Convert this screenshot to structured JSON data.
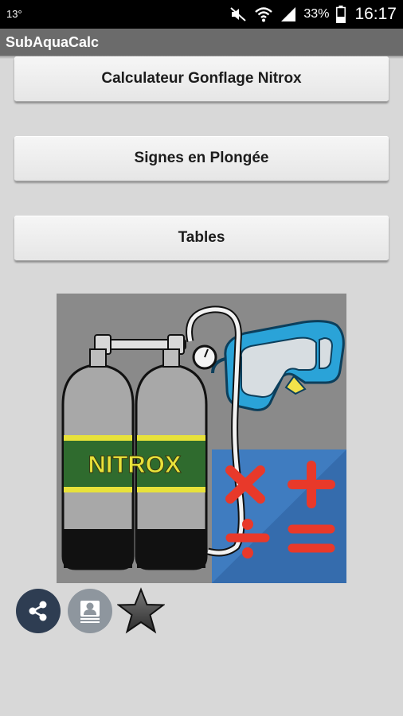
{
  "status_bar": {
    "temperature": "13°",
    "battery_percent": "33%",
    "time": "16:17",
    "icons": [
      "mute-icon",
      "wifi-icon",
      "signal-icon",
      "battery-icon"
    ]
  },
  "app": {
    "title": "SubAquaCalc"
  },
  "menu": {
    "buttons": [
      {
        "label": "Calculateur Gonflage Nitrox"
      },
      {
        "label": "Signes en Plongée"
      },
      {
        "label": "Tables"
      }
    ]
  },
  "illustration": {
    "tank_label": "NITROX",
    "icon": "nitrox-calculator-illustration"
  },
  "actions": {
    "icons": [
      "share-icon",
      "contact-icon",
      "star-icon"
    ]
  },
  "colors": {
    "background": "#d8d8d8",
    "action_bar": "#6b6b6b",
    "share_button": "#2e3d52",
    "contact_button": "#8e969e",
    "calc_panel": "#3f7cc0",
    "math_symbols": "#e8392a",
    "mask": "#2aa3d8",
    "tank_band": "#2f6b2e",
    "tank_band_text": "#e8e23a"
  }
}
